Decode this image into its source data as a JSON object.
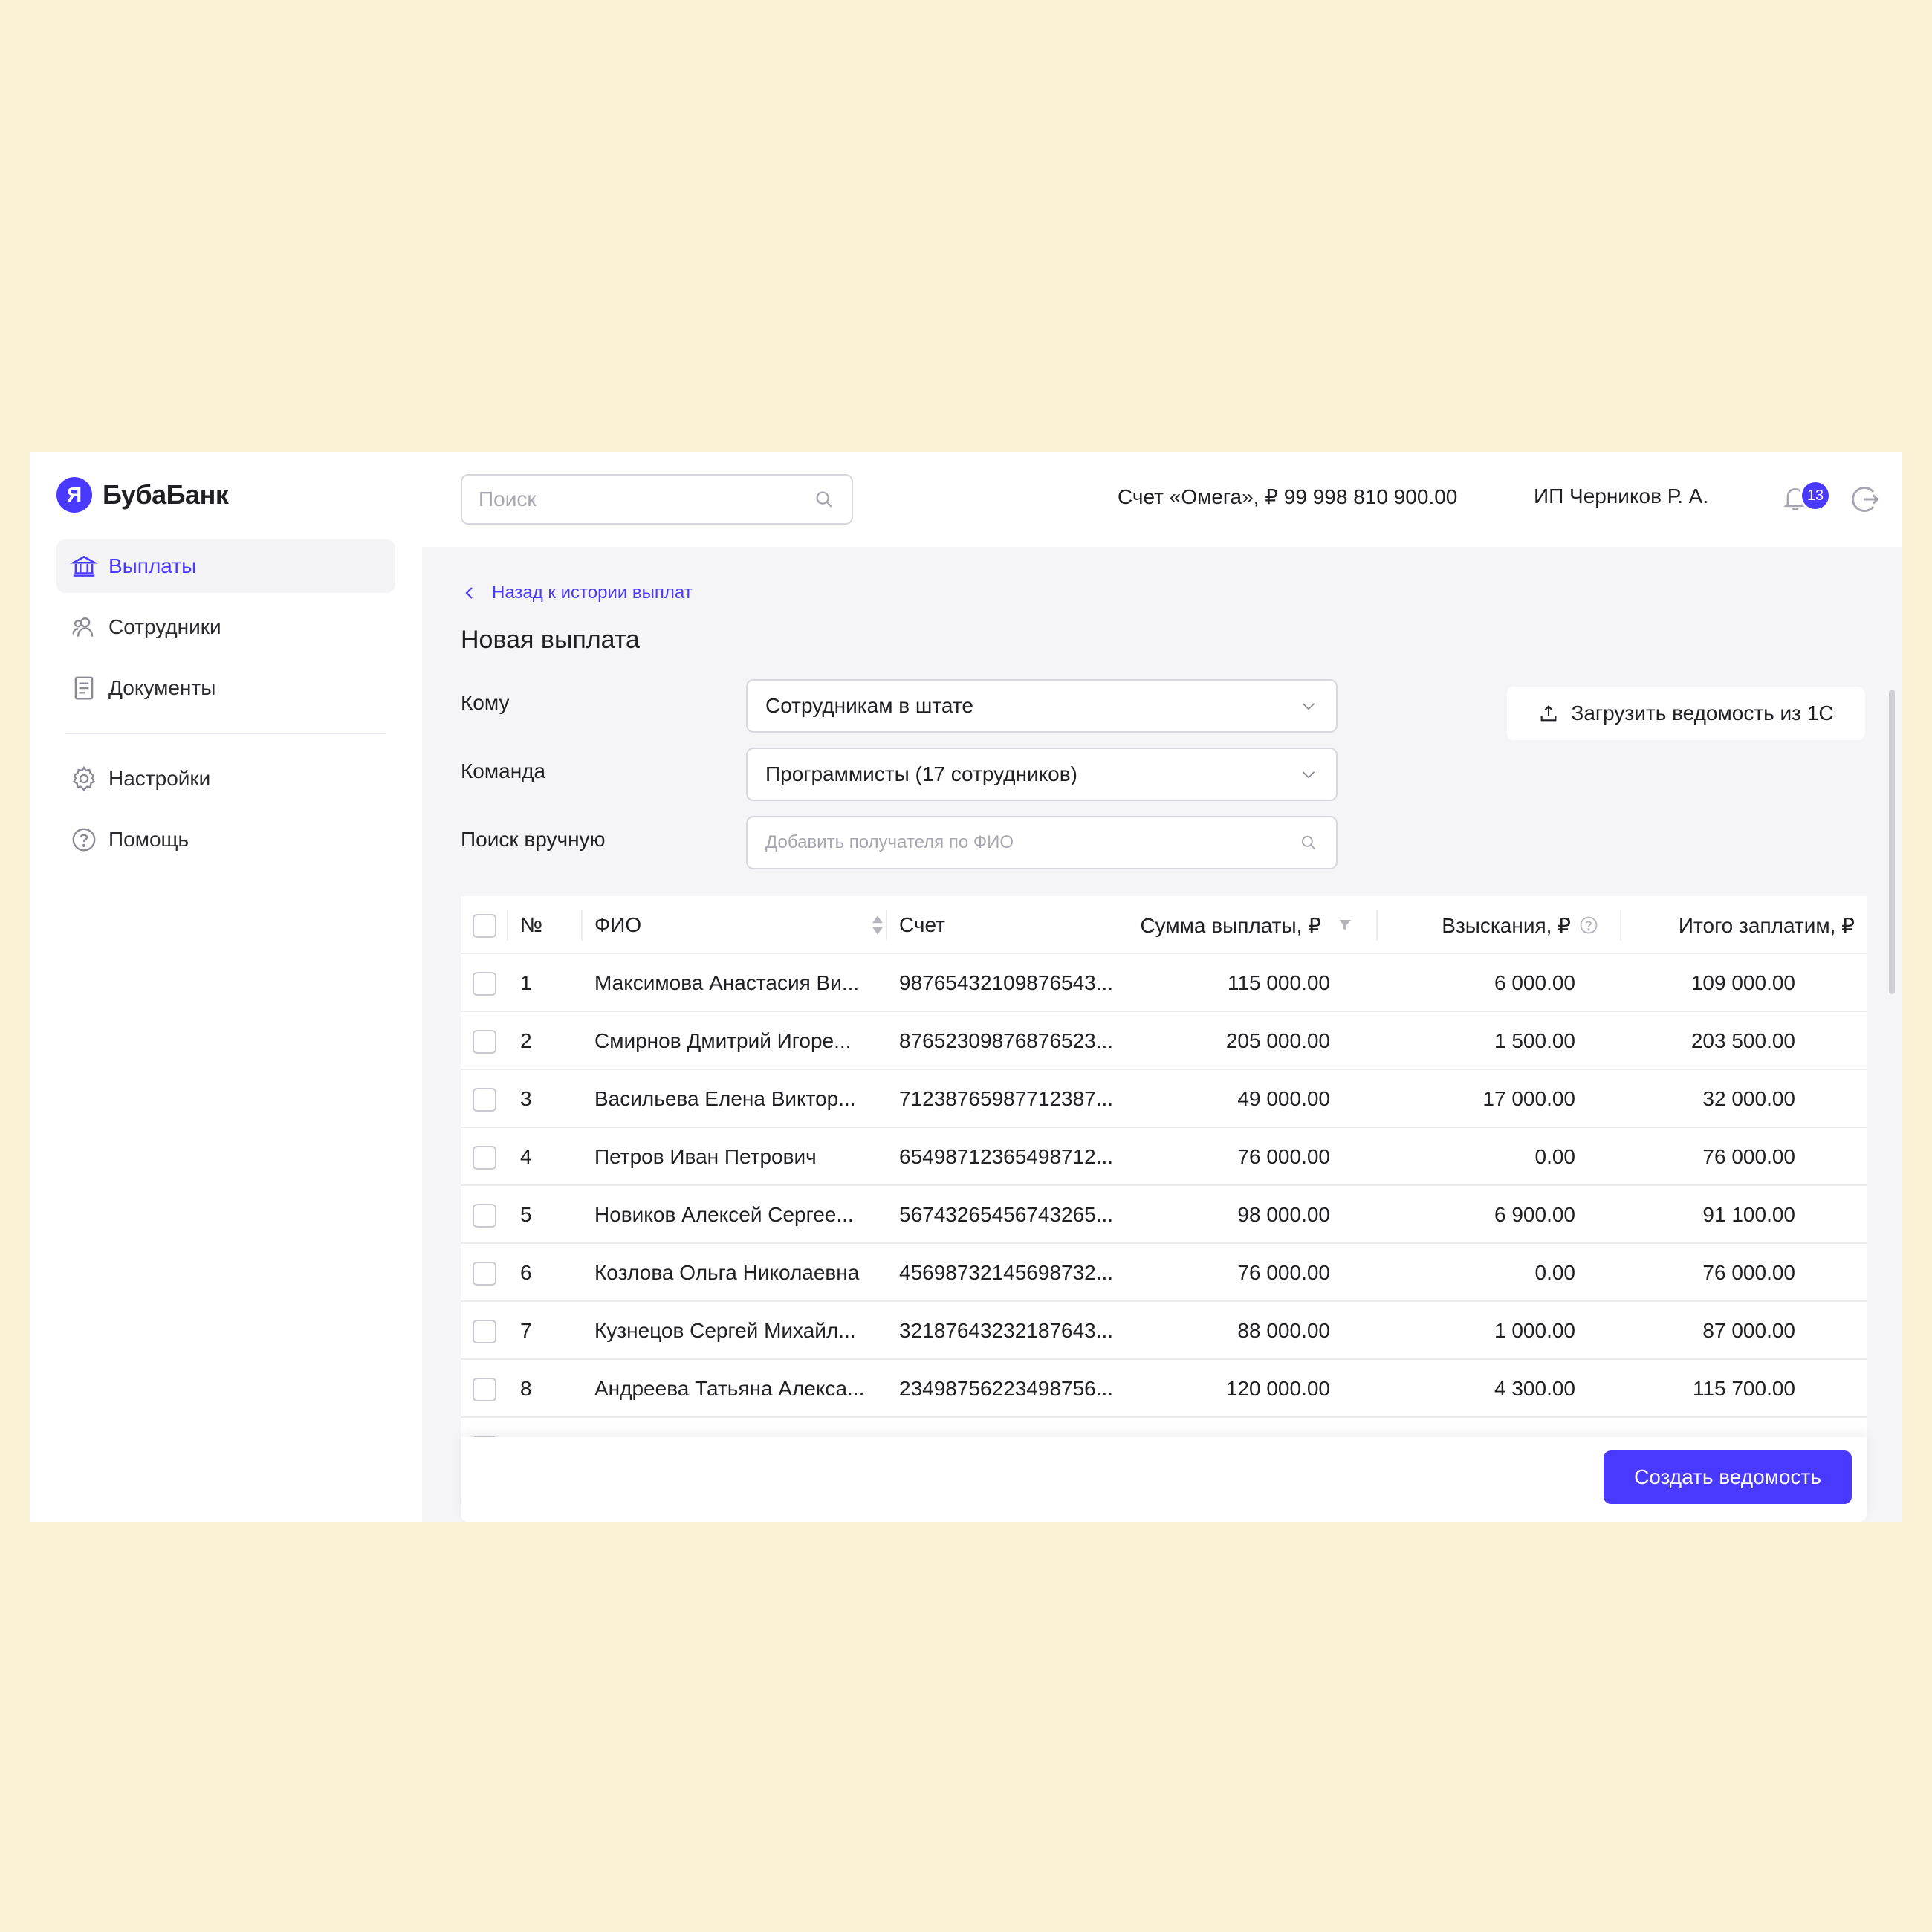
{
  "brand": {
    "logo_letter": "Я",
    "name": "БубаБанк",
    "accent": "#4A3AFF"
  },
  "sidebar": {
    "items": [
      {
        "label": "Выплаты",
        "icon": "bank-icon",
        "active": true
      },
      {
        "label": "Сотрудники",
        "icon": "users-icon",
        "active": false
      },
      {
        "label": "Документы",
        "icon": "document-icon",
        "active": false
      }
    ],
    "secondary": [
      {
        "label": "Настройки",
        "icon": "gear-icon"
      },
      {
        "label": "Помощь",
        "icon": "help-icon"
      }
    ]
  },
  "header": {
    "search_placeholder": "Поиск",
    "account": "Счет «Омега», ₽ 99 998 810 900.00",
    "user": "ИП Черников Р. А.",
    "notifications_count": "13"
  },
  "main": {
    "back_link": "Назад к истории выплат",
    "title": "Новая выплата",
    "form": {
      "to_label": "Кому",
      "to_value": "Сотрудникам в штате",
      "team_label": "Команда",
      "team_value": "Программисты (17 сотрудников)",
      "manual_label": "Поиск вручную",
      "manual_placeholder": "Добавить получателя по ФИО"
    },
    "upload_button": "Загрузить ведомость из 1С",
    "create_button": "Создать ведомость"
  },
  "table": {
    "headers": {
      "num": "№",
      "name": "ФИО",
      "account": "Счет",
      "sum": "Сумма выплаты, ₽",
      "penalties": "Взыскания, ₽",
      "total": "Итого заплатим, ₽"
    },
    "rows": [
      {
        "num": "1",
        "name": "Максимова Анастасия Ви...",
        "account": "98765432109876543...",
        "sum": "115 000.00",
        "penalties": "6 000.00",
        "total": "109 000.00"
      },
      {
        "num": "2",
        "name": "Смирнов Дмитрий Игоре...",
        "account": "87652309876876523...",
        "sum": "205 000.00",
        "penalties": "1 500.00",
        "total": "203 500.00"
      },
      {
        "num": "3",
        "name": "Васильева Елена Виктор...",
        "account": "71238765987712387...",
        "sum": "49 000.00",
        "penalties": "17 000.00",
        "total": "32 000.00"
      },
      {
        "num": "4",
        "name": "Петров Иван Петрович",
        "account": "65498712365498712...",
        "sum": "76 000.00",
        "penalties": "0.00",
        "total": "76 000.00"
      },
      {
        "num": "5",
        "name": "Новиков Алексей Сергее...",
        "account": "56743265456743265...",
        "sum": "98 000.00",
        "penalties": "6 900.00",
        "total": "91 100.00"
      },
      {
        "num": "6",
        "name": "Козлова Ольга Николаевна",
        "account": "45698732145698732...",
        "sum": "76 000.00",
        "penalties": "0.00",
        "total": "76 000.00"
      },
      {
        "num": "7",
        "name": "Кузнецов Сергей Михайл...",
        "account": "32187643232187643...",
        "sum": "88 000.00",
        "penalties": "1 000.00",
        "total": "87 000.00"
      },
      {
        "num": "8",
        "name": "Андреева Татьяна Алекса...",
        "account": "23498756223498756...",
        "sum": "120 000.00",
        "penalties": "4 300.00",
        "total": "115 700.00"
      }
    ]
  }
}
